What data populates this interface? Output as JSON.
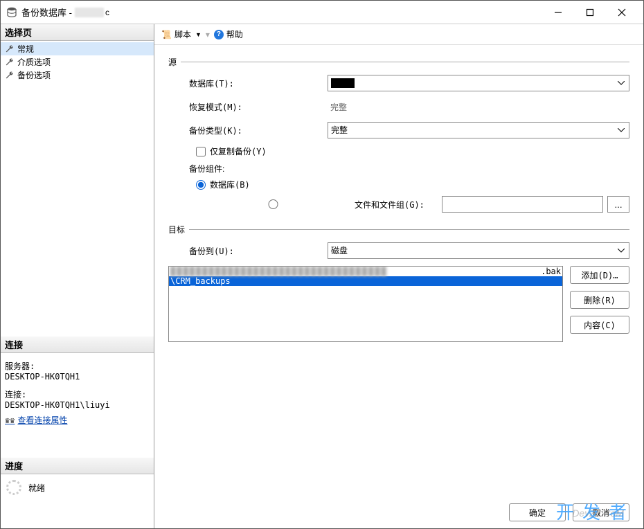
{
  "window": {
    "title": "备份数据库 -",
    "redacted_suffix": "c"
  },
  "sidebar": {
    "select_page_header": "选择页",
    "items": [
      {
        "label": "常规",
        "selected": true
      },
      {
        "label": "介质选项",
        "selected": false
      },
      {
        "label": "备份选项",
        "selected": false
      }
    ],
    "connection_header": "连接",
    "server_label": "服务器:",
    "server_value": "DESKTOP-HK0TQH1",
    "conn_label": "连接:",
    "conn_value": "DESKTOP-HK0TQH1\\liuyi",
    "view_conn_props": "查看连接属性",
    "progress_header": "进度",
    "progress_status": "就绪"
  },
  "toolbar": {
    "script_label": "脚本",
    "help_label": "帮助"
  },
  "source": {
    "group_label": "源",
    "database_label": "数据库(T):",
    "database_value": "",
    "recovery_label": "恢复模式(M):",
    "recovery_value": "完整",
    "backup_type_label": "备份类型(K):",
    "backup_type_value": "完整",
    "copy_only_label": "仅复制备份(Y)",
    "component_label": "备份组件:",
    "radio_db_label": "数据库(B)",
    "radio_files_label": "文件和文件组(G):"
  },
  "destination": {
    "group_label": "目标",
    "backup_to_label": "备份到(U):",
    "backup_to_value": "磁盘",
    "list": [
      {
        "text_suffix": ".bak",
        "selected": false,
        "blurred": true
      },
      {
        "text": "\\CRM_backups",
        "selected": true
      }
    ],
    "add_btn": "添加(D)…",
    "remove_btn": "删除(R)",
    "contents_btn": "内容(C)"
  },
  "footer": {
    "ok": "确定",
    "cancel": "取消"
  },
  "watermark": "开发者",
  "watermark2": "DevZe.CoM"
}
